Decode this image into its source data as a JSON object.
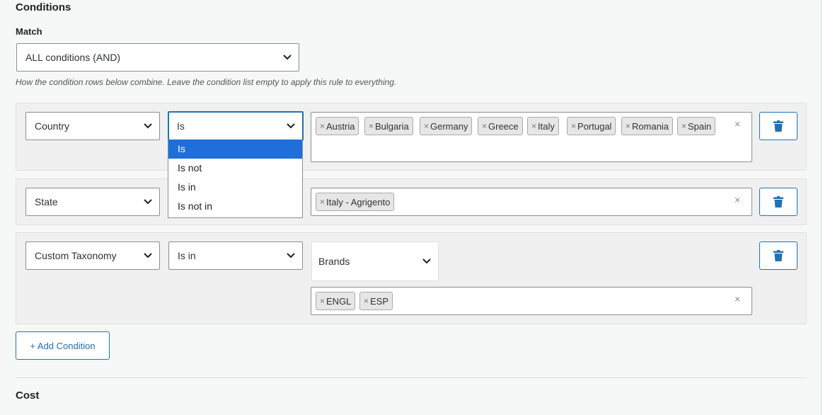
{
  "conditions_title": "Conditions",
  "match": {
    "label": "Match",
    "selected": "ALL conditions (AND)",
    "help": "How the condition rows below combine. Leave the condition list empty to apply this rule to everything."
  },
  "rows": [
    {
      "field": "Country",
      "operator": "Is",
      "tags": [
        "Austria",
        "Bulgaria",
        "Germany",
        "Greece",
        "Italy",
        "Portugal",
        "Romania",
        "Spain"
      ]
    },
    {
      "field": "State",
      "operator": "",
      "tags": [
        "Italy - Agrigento"
      ]
    },
    {
      "field": "Custom Taxonomy",
      "operator": "Is in",
      "taxonomy": "Brands",
      "tags": [
        "ENGL",
        "ESP"
      ]
    }
  ],
  "operator_dropdown": {
    "options": [
      "Is",
      "Is not",
      "Is in",
      "Is not in"
    ],
    "active": "Is"
  },
  "tag_remove_symbol": "×",
  "clear_symbol": "×",
  "add_condition_label": "+ Add Condition",
  "cost_title": "Cost",
  "colors": {
    "accent": "#2271b1",
    "dropdown_active": "#1e6fd9",
    "panel_bg": "#f6f7f7",
    "row_bg": "#f0f0f1"
  },
  "icons": {
    "chevron": "chevron-down-icon",
    "delete": "trash-icon"
  }
}
